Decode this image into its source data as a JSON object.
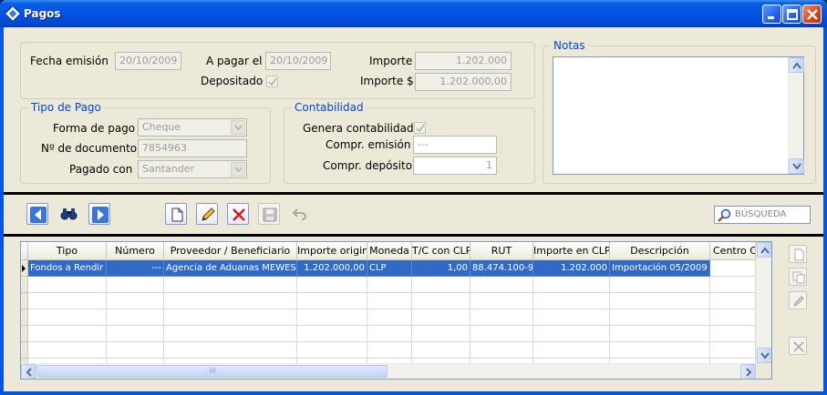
{
  "window": {
    "title": "Pagos"
  },
  "header": {
    "fecha_emision_label": "Fecha emisión",
    "fecha_emision": "20/10/2009",
    "a_pagar_label": "A pagar el",
    "a_pagar": "20/10/2009",
    "depositado_label": "Depositado",
    "importe_label": "Importe",
    "importe": "1.202.000",
    "importe_dolar_label": "Importe $",
    "importe_dolar": "1.202.000,00"
  },
  "notas": {
    "legend": "Notas"
  },
  "tipo_pago": {
    "legend": "Tipo de Pago",
    "forma_label": "Forma de pago",
    "forma": "Cheque",
    "documento_label": "Nº de documento",
    "documento": "7854963",
    "pagado_label": "Pagado con",
    "pagado": "Santander"
  },
  "contabilidad": {
    "legend": "Contabilidad",
    "genera_label": "Genera contabilidad",
    "emision_label": "Compr. emisión",
    "emision": "---",
    "deposito_label": "Compr. depósito",
    "deposito": "1"
  },
  "toolbar": {
    "search_placeholder": "BÚSQUEDA"
  },
  "grid": {
    "columns": [
      "Tipo",
      "Número",
      "Proveedor / Beneficiario",
      "Importe original",
      "Moneda",
      "T/C con CLP",
      "RUT",
      "Importe en CLP",
      "Descripción",
      "Centro Cos"
    ],
    "rows": [
      [
        "Fondos a Rendir",
        "---",
        "Agencia de Aduanas MEWES",
        "1.202.000,00",
        "CLP",
        "1,00",
        "88.474.100-9",
        "1.202.000",
        "Importación 05/2009",
        ""
      ]
    ],
    "hscroll_grip": "III"
  },
  "colors": {
    "accent": "#0046d5",
    "selection": "#316ac5",
    "titlebar": "#0054e3"
  }
}
